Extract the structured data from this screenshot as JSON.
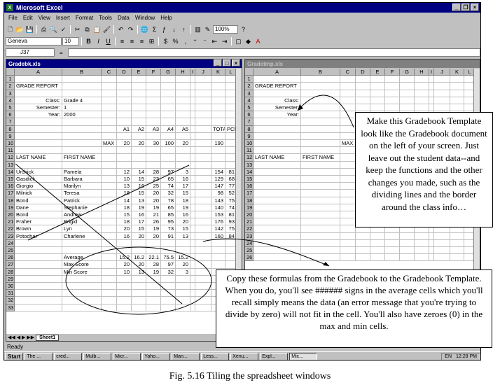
{
  "app": {
    "title": "Microsoft Excel",
    "icon": "excel-icon"
  },
  "menu": [
    "File",
    "Edit",
    "View",
    "Insert",
    "Format",
    "Tools",
    "Data",
    "Window",
    "Help"
  ],
  "toolbar": {
    "zoom": "100%",
    "font": "Geneva",
    "size": "10"
  },
  "formula_bar": {
    "name_box": "J37",
    "fx": "="
  },
  "left_doc": {
    "title": "Gradebk.xls",
    "columns": [
      "A",
      "B",
      "C",
      "D",
      "E",
      "F",
      "G",
      "H",
      "I",
      "J",
      "K",
      "L"
    ],
    "sheet_tab": "Sheet1",
    "rows": [
      [
        "1",
        "",
        "",
        "",
        "",
        "",
        "",
        "",
        "",
        "",
        "",
        ""
      ],
      [
        "2",
        "GRADE REPORT",
        "",
        "",
        "",
        "",
        "",
        "",
        "",
        "",
        "",
        ""
      ],
      [
        "3",
        "",
        "",
        "",
        "",
        "",
        "",
        "",
        "",
        "",
        "",
        ""
      ],
      [
        "4",
        "Class:",
        "Grade 4",
        "",
        "",
        "",
        "",
        "",
        "",
        "",
        "",
        ""
      ],
      [
        "5",
        "Semester:",
        "1",
        "",
        "",
        "",
        "",
        "",
        "",
        "",
        "",
        ""
      ],
      [
        "6",
        "Year:",
        "2000",
        "",
        "",
        "",
        "",
        "",
        "",
        "",
        "",
        ""
      ],
      [
        "7",
        "",
        "",
        "",
        "",
        "",
        "",
        "",
        "",
        "",
        "",
        ""
      ],
      [
        "8",
        "",
        "",
        "",
        "A1",
        "A2",
        "A3",
        "A4",
        "A5",
        "",
        "TOTAL",
        "PCN"
      ],
      [
        "9",
        "",
        "",
        "",
        "",
        "",
        "",
        "",
        "",
        "",
        "",
        ""
      ],
      [
        "10",
        "",
        "",
        "MAX",
        "20",
        "20",
        "30",
        "100",
        "20",
        "",
        "190",
        ""
      ],
      [
        "11",
        "",
        "",
        "",
        "",
        "",
        "",
        "",
        "",
        "",
        "",
        ""
      ],
      [
        "12",
        "LAST NAME",
        "FIRST NAME",
        "",
        "",
        "",
        "",
        "",
        "",
        "",
        "",
        ""
      ],
      [
        "13",
        "",
        "",
        "",
        "",
        "",
        "",
        "",
        "",
        "",
        "",
        ""
      ],
      [
        "14",
        "Urchick",
        "Pamela",
        "",
        "12",
        "14",
        "28",
        "97",
        "3",
        "",
        "154",
        "81"
      ],
      [
        "15",
        "Gasdick",
        "Barbara",
        "",
        "10",
        "15",
        "23",
        "65",
        "16",
        "",
        "129",
        "68"
      ],
      [
        "16",
        "Giorgio",
        "Marilyn",
        "",
        "13",
        "16",
        "25",
        "74",
        "17",
        "",
        "147",
        "77"
      ],
      [
        "17",
        "Milnick",
        "Teresa",
        "",
        "18",
        "15",
        "20",
        "32",
        "15",
        "",
        "98",
        "52"
      ],
      [
        "18",
        "Bond",
        "Patrick",
        "",
        "14",
        "13",
        "20",
        "78",
        "18",
        "",
        "143",
        "75"
      ],
      [
        "19",
        "Dane",
        "Stephanie",
        "",
        "18",
        "19",
        "19",
        "65",
        "19",
        "",
        "140",
        "74"
      ],
      [
        "20",
        "Bond",
        "Andrew",
        "",
        "15",
        "16",
        "21",
        "85",
        "16",
        "",
        "153",
        "81"
      ],
      [
        "21",
        "Fraher",
        "Brigid",
        "",
        "18",
        "17",
        "26",
        "95",
        "20",
        "",
        "176",
        "93"
      ],
      [
        "22",
        "Brown",
        "Lyn",
        "",
        "20",
        "15",
        "19",
        "73",
        "15",
        "",
        "142",
        "75"
      ],
      [
        "23",
        "Potochar",
        "Charlene",
        "",
        "16",
        "20",
        "20",
        "91",
        "13",
        "",
        "160",
        "84"
      ],
      [
        "24",
        "",
        "",
        "",
        "",
        "",
        "",
        "",
        "",
        "",
        "",
        ""
      ],
      [
        "25",
        "",
        "",
        "",
        "",
        "",
        "",
        "",
        "",
        "",
        "",
        ""
      ],
      [
        "26",
        "",
        "Average",
        "",
        "15.2",
        "16.2",
        "22.1",
        "75.5",
        "15.2",
        "",
        "",
        ""
      ],
      [
        "27",
        "",
        "Max Score",
        "",
        "20",
        "20",
        "28",
        "97",
        "20",
        "",
        "",
        ""
      ],
      [
        "28",
        "",
        "Min Score",
        "",
        "10",
        "13",
        "19",
        "32",
        "3",
        "",
        "",
        ""
      ],
      [
        "29",
        "",
        "",
        "",
        "",
        "",
        "",
        "",
        "",
        "",
        "",
        ""
      ],
      [
        "30",
        "",
        "",
        "",
        "",
        "",
        "",
        "",
        "",
        "",
        "",
        ""
      ],
      [
        "31",
        "",
        "",
        "",
        "",
        "",
        "",
        "",
        "",
        "",
        "",
        ""
      ],
      [
        "32",
        "",
        "",
        "",
        "",
        "",
        "",
        "",
        "",
        "",
        "",
        ""
      ],
      [
        "33",
        "",
        "",
        "",
        "",
        "",
        "",
        "",
        "",
        "",
        "",
        ""
      ]
    ]
  },
  "right_doc": {
    "title": "Gradetmp.xls",
    "columns": [
      "A",
      "B",
      "C",
      "D",
      "E",
      "F",
      "G",
      "H",
      "I",
      "J",
      "K",
      "L"
    ],
    "rows": [
      [
        "1",
        "",
        "",
        "",
        "",
        "",
        "",
        "",
        "",
        "",
        "",
        ""
      ],
      [
        "2",
        "GRADE REPORT",
        "",
        "",
        "",
        "",
        "",
        "",
        "",
        "",
        "",
        ""
      ],
      [
        "3",
        "",
        "",
        "",
        "",
        "",
        "",
        "",
        "",
        "",
        "",
        ""
      ],
      [
        "4",
        "Class:",
        "",
        "",
        "",
        "",
        "",
        "",
        "",
        "",
        "",
        ""
      ],
      [
        "5",
        "Semester:",
        "",
        "",
        "",
        "",
        "",
        "",
        "",
        "",
        "",
        ""
      ],
      [
        "6",
        "Year:",
        "",
        "",
        "",
        "",
        "",
        "",
        "",
        "",
        "",
        ""
      ],
      [
        "7",
        "",
        "",
        "",
        "",
        "",
        "",
        "",
        "",
        "",
        "",
        ""
      ],
      [
        "8",
        "",
        "",
        "",
        "",
        "",
        "",
        "",
        "",
        "",
        "",
        ""
      ],
      [
        "9",
        "",
        "",
        "",
        "",
        "",
        "",
        "",
        "",
        "",
        "",
        ""
      ],
      [
        "10",
        "",
        "",
        "MAX",
        "",
        "",
        "",
        "",
        "",
        "",
        "",
        ""
      ],
      [
        "11",
        "",
        "",
        "",
        "",
        "",
        "",
        "",
        "",
        "",
        "",
        ""
      ],
      [
        "12",
        "LAST NAME",
        "FIRST NAME",
        "",
        "",
        "",
        "",
        "",
        "",
        "",
        "",
        ""
      ],
      [
        "13",
        "",
        "",
        "",
        "",
        "",
        "",
        "",
        "",
        "",
        "",
        ""
      ],
      [
        "14",
        "",
        "",
        "",
        "",
        "",
        "",
        "",
        "",
        "",
        "",
        ""
      ],
      [
        "15",
        "",
        "",
        "",
        "",
        "",
        "",
        "",
        "",
        "",
        "",
        ""
      ],
      [
        "16",
        "",
        "",
        "",
        "",
        "",
        "",
        "",
        "",
        "",
        "",
        ""
      ],
      [
        "17",
        "",
        "",
        "",
        "",
        "",
        "",
        "",
        "",
        "",
        "",
        ""
      ],
      [
        "18",
        "",
        "",
        "",
        "",
        "",
        "",
        "",
        "",
        "",
        "",
        ""
      ],
      [
        "19",
        "",
        "",
        "",
        "",
        "",
        "",
        "",
        "",
        "",
        "",
        ""
      ],
      [
        "20",
        "",
        "",
        "",
        "",
        "",
        "",
        "",
        "",
        "",
        "",
        ""
      ],
      [
        "21",
        "",
        "",
        "",
        "",
        "",
        "",
        "",
        "",
        "",
        "",
        ""
      ],
      [
        "22",
        "",
        "",
        "",
        "",
        "",
        "",
        "",
        "",
        "",
        "",
        ""
      ],
      [
        "23",
        "",
        "",
        "",
        "",
        "",
        "",
        "",
        "",
        "",
        "",
        ""
      ],
      [
        "24",
        "",
        "",
        "",
        "",
        "",
        "",
        "",
        "",
        "",
        "",
        ""
      ],
      [
        "25",
        "",
        "",
        "",
        "",
        "",
        "",
        "",
        "",
        "",
        "",
        ""
      ],
      [
        "26",
        "",
        "",
        "",
        "",
        "",
        "",
        "",
        "",
        "",
        "",
        ""
      ]
    ]
  },
  "status": "Ready",
  "taskbar": {
    "start": "Start",
    "tasks": [
      "The ...",
      "cred...",
      "Mulb...",
      "Micr...",
      "Yaho...",
      "Man...",
      "Less...",
      "Xenu...",
      "Expl...",
      "Mic..."
    ],
    "clock": "12:28 PM",
    "tray_lang": "EN"
  },
  "callout1": "Make this Gradebook Template look like the Gradebook document on the left of your screen. Just leave out the student data--and keep the functions and the other changes you made, such as the dividing lines and the border around the class info…",
  "callout2": "Copy these formulas from the Gradebook to the Gradebook Template.  When you do, you'll see ###### signs in the average cells which you'll recall simply means the data (an error message that you're trying to divide by zero) will not fit in the cell. You'll also have zeroes (0) in the max and min cells.",
  "caption": "Fig. 5.16 Tiling the spreadsheet windows"
}
